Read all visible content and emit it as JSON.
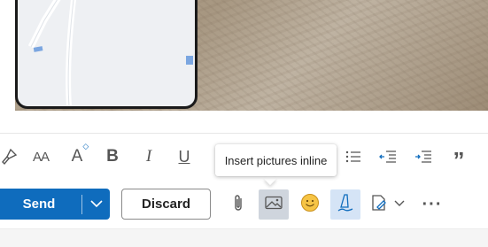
{
  "toolbar": {
    "format_painter": {
      "icon": "paintbrush-icon"
    },
    "font_size": {
      "icon": "font-size-icon",
      "glyph": "AA"
    },
    "font_grow": {
      "icon": "grow-font-icon",
      "glyph": "A"
    },
    "bold": {
      "icon": "bold-icon",
      "glyph": "B"
    },
    "italic": {
      "icon": "italic-icon",
      "glyph": "I"
    },
    "underline": {
      "icon": "underline-icon",
      "glyph": "U"
    },
    "bullets": {
      "icon": "bulleted-list-icon"
    },
    "decrease_indent": {
      "icon": "decrease-indent-icon"
    },
    "increase_indent": {
      "icon": "increase-indent-icon"
    },
    "quote": {
      "icon": "quote-icon",
      "glyph": "”"
    }
  },
  "tooltip": {
    "text": "Insert pictures inline"
  },
  "actions": {
    "send_label": "Send",
    "discard_label": "Discard",
    "attach": {
      "icon": "paperclip-icon"
    },
    "insert_picture": {
      "icon": "insert-picture-icon"
    },
    "emoji": {
      "icon": "emoji-icon"
    },
    "signature": {
      "icon": "signature-pen-icon"
    },
    "editor": {
      "icon": "editor-icon"
    },
    "more": {
      "icon": "more-icon",
      "glyph": "···"
    }
  },
  "colors": {
    "accent": "#0f6cbd",
    "active_button": "#cfd5dd",
    "checked_button": "#d5e4f6",
    "emoji_yellow": "#f6c445"
  }
}
